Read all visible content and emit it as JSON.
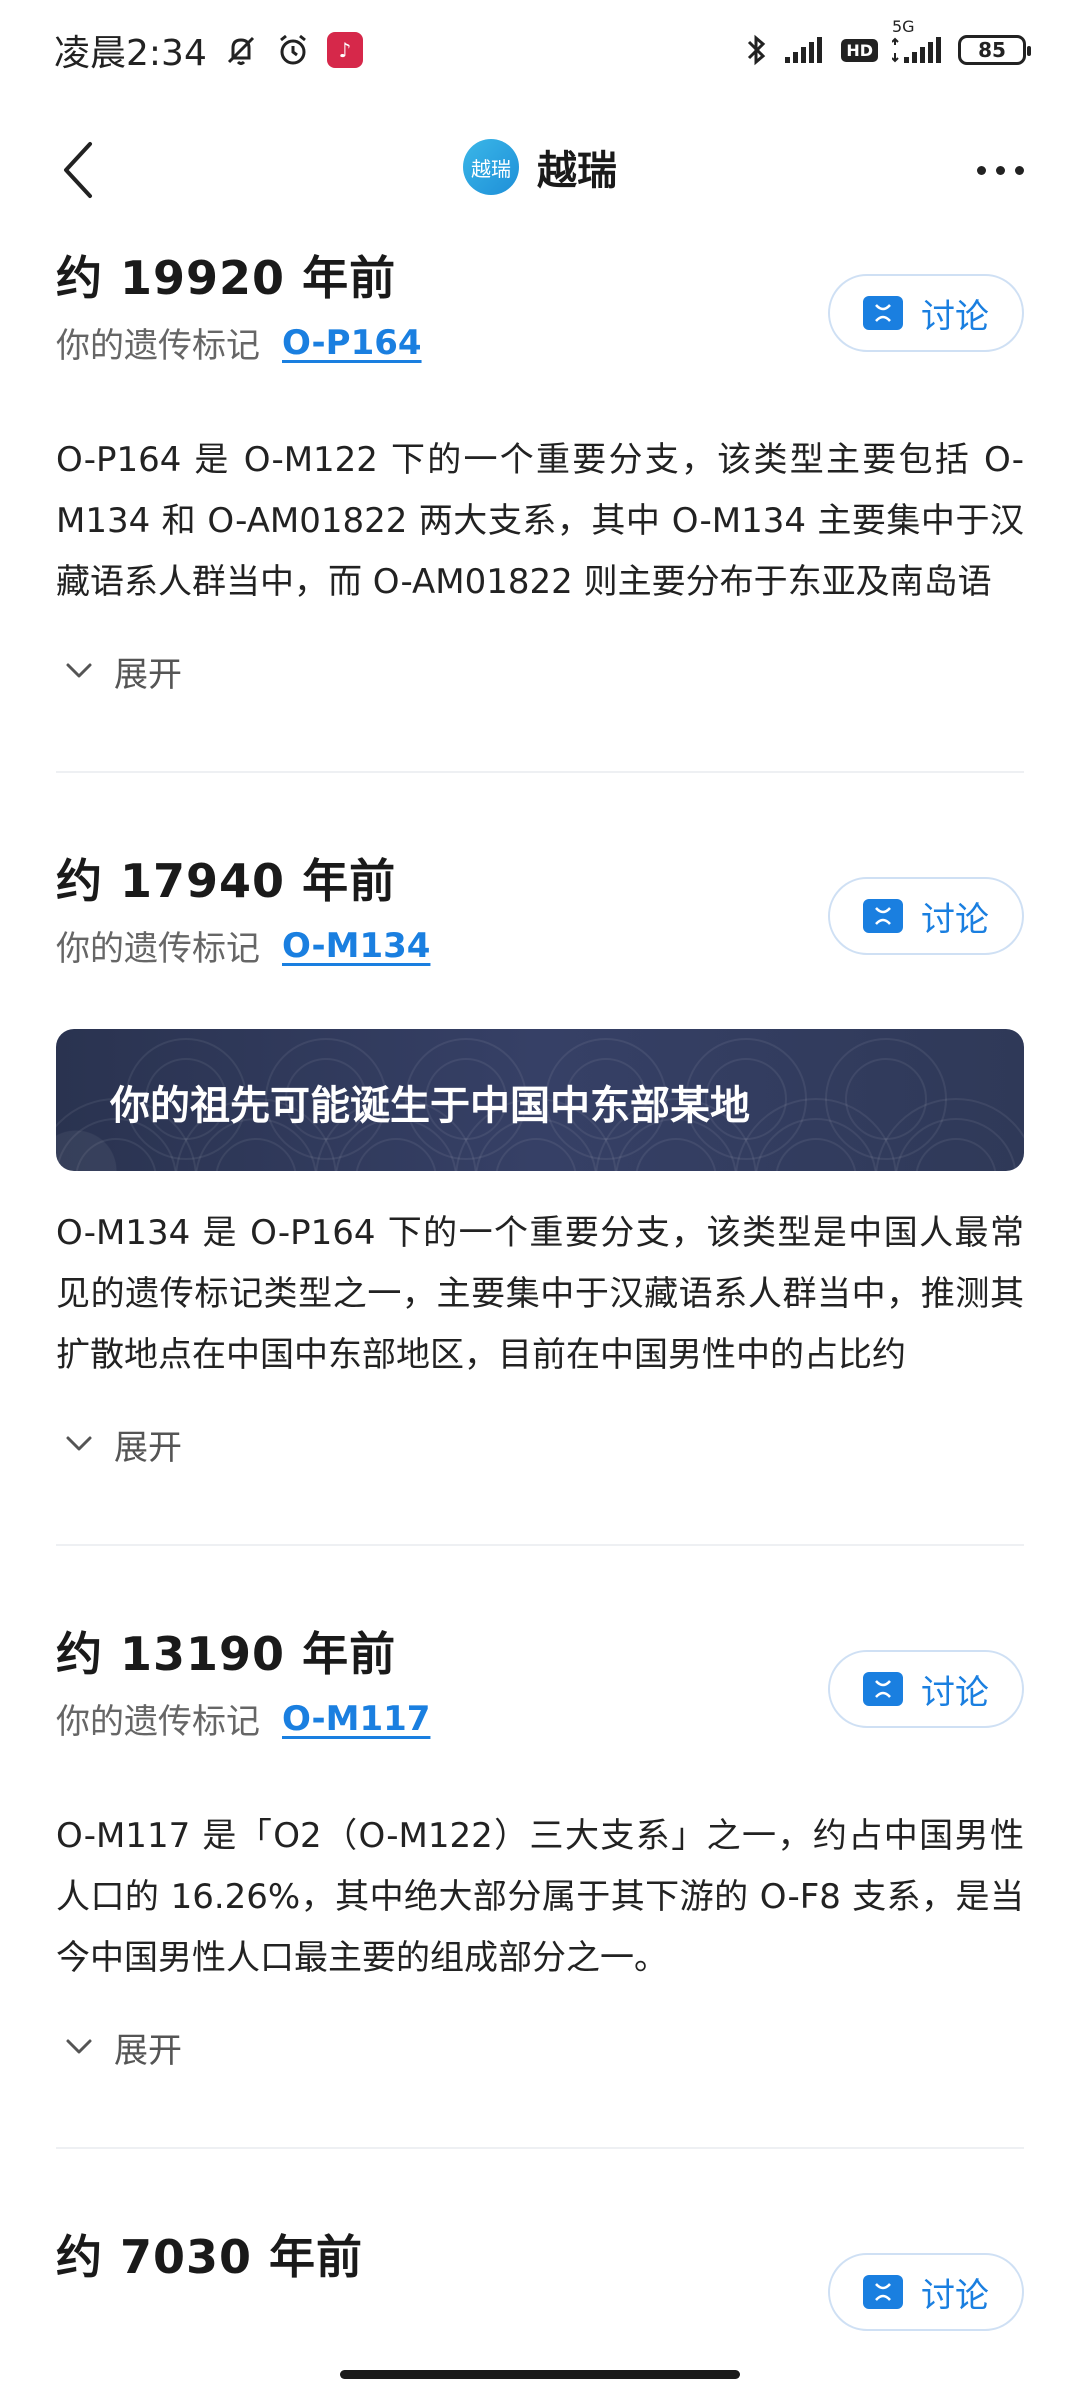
{
  "status_bar": {
    "time": "凌晨2:34",
    "app_icon": "douyin-icon",
    "hd": "HD",
    "network": "5G",
    "battery": "85"
  },
  "nav": {
    "logo_text": "越瑞",
    "title": "越瑞"
  },
  "sections": [
    {
      "era": "约 19920 年前",
      "marker_label": "你的遗传标记",
      "marker": "O-P164",
      "discuss": "讨论",
      "banner": "",
      "description": "O-P164 是 O-M122 下的一个重要分支，该类型主要包括 O-M134 和 O-AM01822 两大支系，其中 O-M134 主要集中于汉藏语系人群当中，而 O-AM01822 则主要分布于东亚及南岛语",
      "expand": "展开"
    },
    {
      "era": "约 17940 年前",
      "marker_label": "你的遗传标记",
      "marker": "O-M134",
      "discuss": "讨论",
      "banner": "你的祖先可能诞生于中国中东部某地",
      "description": "O-M134 是 O-P164 下的一个重要分支，该类型是中国人最常见的遗传标记类型之一，主要集中于汉藏语系人群当中，推测其扩散地点在中国中东部地区，目前在中国男性中的占比约",
      "expand": "展开"
    },
    {
      "era": "约 13190 年前",
      "marker_label": "你的遗传标记",
      "marker": "O-M117",
      "discuss": "讨论",
      "banner": "",
      "description": "O-M117 是「O2（O-M122）三大支系」之一，约占中国男性人口的 16.26%，其中绝大部分属于其下游的 O-F8 支系，是当今中国男性人口最主要的组成部分之一。",
      "expand": "展开"
    },
    {
      "era": "约 7030 年前",
      "discuss": "讨论"
    }
  ]
}
